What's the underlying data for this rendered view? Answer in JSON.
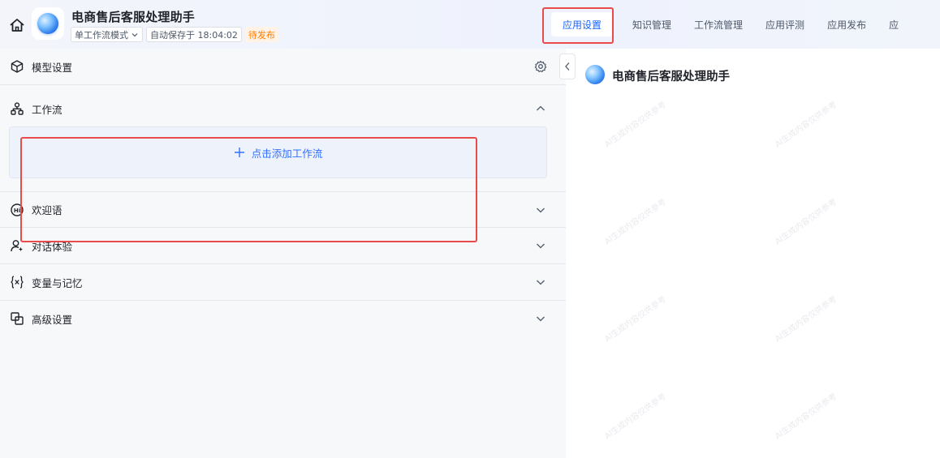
{
  "header": {
    "app_title": "电商售后客服处理助手",
    "mode": "单工作流模式",
    "autosave": "自动保存于 18:04:02",
    "status": "待发布",
    "tabs": [
      {
        "label": "应用设置",
        "active": true
      },
      {
        "label": "知识管理",
        "active": false
      },
      {
        "label": "工作流管理",
        "active": false
      },
      {
        "label": "应用评测",
        "active": false
      },
      {
        "label": "应用发布",
        "active": false
      },
      {
        "label": "应",
        "active": false
      }
    ]
  },
  "left": {
    "model_settings": "模型设置",
    "workflow": {
      "label": "工作流",
      "add_label": "点击添加工作流"
    },
    "sections": [
      {
        "label": "欢迎语",
        "icon": "hi-icon"
      },
      {
        "label": "对话体验",
        "icon": "user-chat-icon"
      },
      {
        "label": "变量与记忆",
        "icon": "variable-icon"
      },
      {
        "label": "高级设置",
        "icon": "copy-icon"
      }
    ]
  },
  "preview": {
    "title": "电商售后客服处理助手",
    "watermark": "AI生成内容仅供参考"
  },
  "colors": {
    "accent": "#1664ff",
    "link": "#3370ff",
    "highlight_box": "#e94a4a",
    "status": "#ff7d00"
  }
}
